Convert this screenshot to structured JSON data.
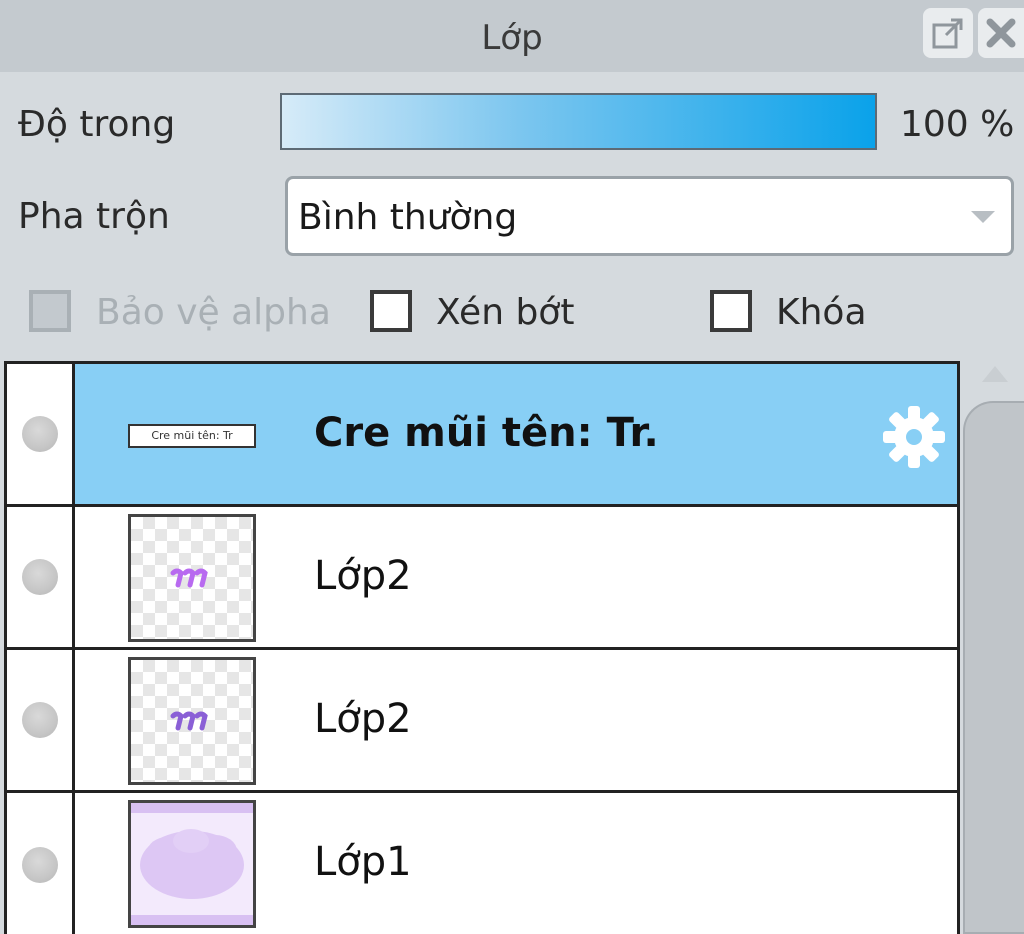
{
  "panel": {
    "title": "Lớp",
    "popout_icon": "popout-icon",
    "close_icon": "close-icon"
  },
  "opacity": {
    "label": "Độ trong",
    "value": 1.0,
    "value_text": "100 %"
  },
  "blend": {
    "label": "Pha trộn",
    "selected": "Bình thường"
  },
  "checkboxes": {
    "alpha": {
      "label": "Bảo vệ alpha",
      "checked": false,
      "disabled": true
    },
    "clip": {
      "label": "Xén bớt",
      "checked": false
    },
    "lock": {
      "label": "Khóa",
      "checked": false
    }
  },
  "layers": [
    {
      "name": "Cre mũi tên: Tr.",
      "selected": true,
      "thumb": "text",
      "thumb_text": "Cre mũi tên: Tr",
      "icon": "gear-icon"
    },
    {
      "name": "Lớp2",
      "selected": false,
      "thumb": "checker-purple-marks"
    },
    {
      "name": "Lớp2",
      "selected": false,
      "thumb": "checker-purple-marks-dark"
    },
    {
      "name": "Lớp1",
      "selected": false,
      "thumb": "purple-cloud"
    }
  ],
  "colors": {
    "selected_row": "#88cff5",
    "slider_end": "#0aa2ea",
    "panel_bg": "#d5dade"
  }
}
